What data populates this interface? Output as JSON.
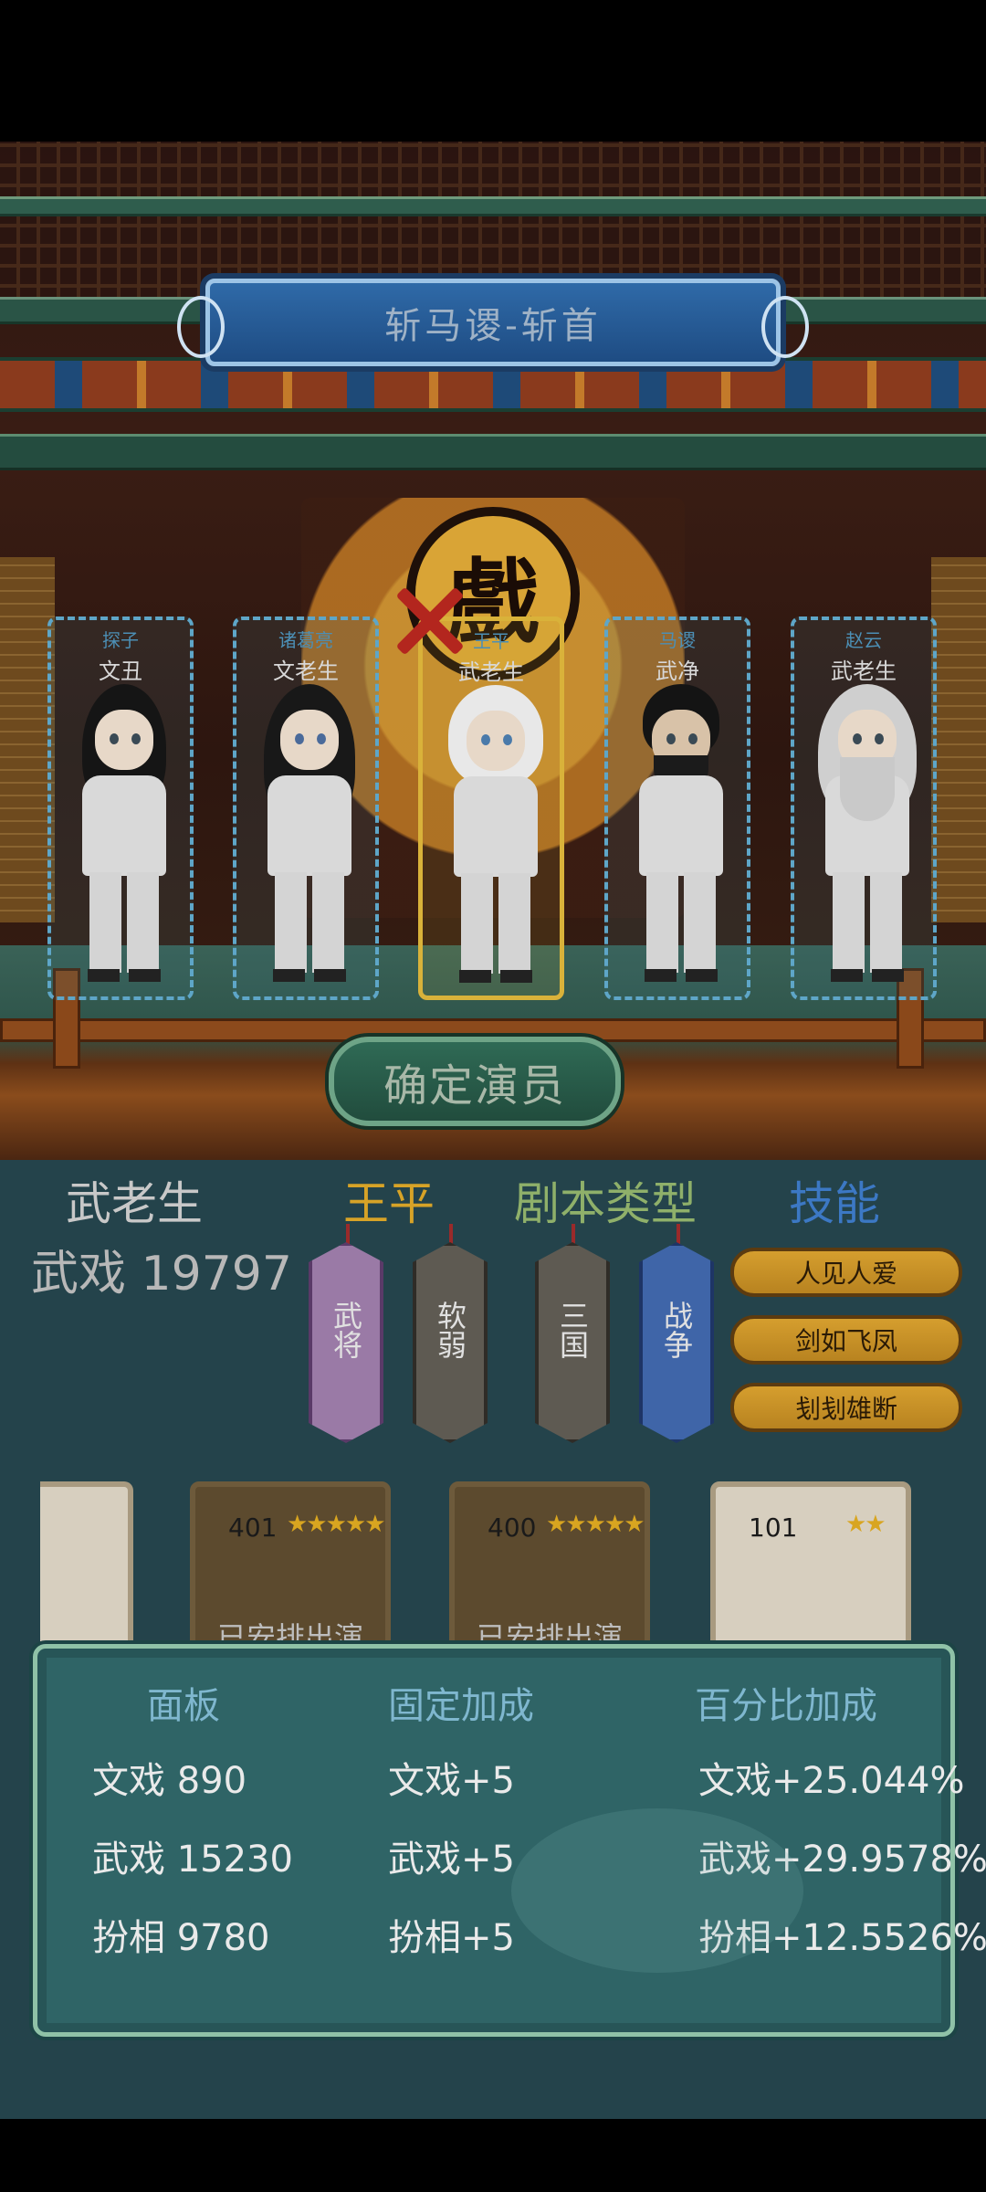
{
  "stage": {
    "title": "斩马谡-斩首",
    "backdrop_char": "戲",
    "confirm_label": "确定演员"
  },
  "slots": [
    {
      "top": "探子",
      "role": "文丑",
      "selected": false
    },
    {
      "top": "诸葛亮",
      "role": "文老生",
      "selected": false
    },
    {
      "top": "王平",
      "role": "武老生",
      "selected": true
    },
    {
      "top": "马谡",
      "role": "武净",
      "selected": false
    },
    {
      "top": "赵云",
      "role": "武老生",
      "selected": false
    }
  ],
  "info": {
    "role_type": "武老生",
    "character": "王平",
    "script_type_label": "剧本类型",
    "skills_label": "技能",
    "power_line": "武戏 19797"
  },
  "tags": [
    "武将",
    "软弱",
    "三国",
    "战争"
  ],
  "skills": [
    "人见人爱",
    "剑如飞凤",
    "刬刬雄断"
  ],
  "cards": [
    {
      "num": "401",
      "stars": "★★★★★",
      "status": "已安排出演"
    },
    {
      "num": "400",
      "stars": "★★★★★",
      "status": "已安排出演"
    },
    {
      "num": "101",
      "stars": "★★",
      "status": ""
    }
  ],
  "stats": {
    "headers": {
      "panel": "面板",
      "fixed": "固定加成",
      "percent": "百分比加成"
    },
    "rows": [
      {
        "panel": "文戏 890",
        "fixed": "文戏+5",
        "percent": "文戏+25.044%"
      },
      {
        "panel": "武戏 15230",
        "fixed": "武戏+5",
        "percent": "武戏+29.9578%"
      },
      {
        "panel": "扮相 9780",
        "fixed": "扮相+5",
        "percent": "扮相+12.5526%"
      }
    ]
  },
  "colors": {
    "role": "#c8c8c8",
    "character": "#d7a327",
    "script": "#8fb06a",
    "skills": "#3c78c4"
  }
}
